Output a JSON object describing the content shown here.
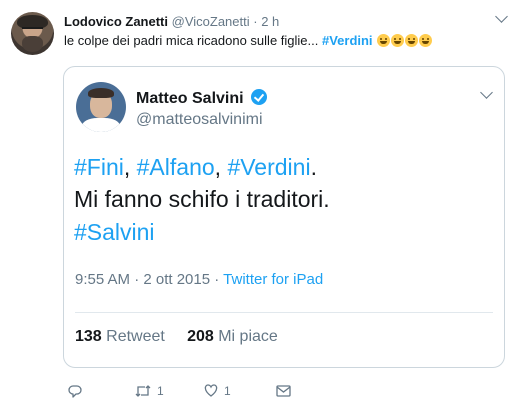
{
  "tweet": {
    "author_name": "Lodovico Zanetti",
    "author_handle": "@VicoZanetti",
    "separator": "·",
    "time": "2 h",
    "text_prefix": "le colpe dei padri mica ricadono sulle figlie... ",
    "hashtag": "#Verdini"
  },
  "quoted": {
    "name": "Matteo Salvini",
    "handle": "@matteosalvinimi",
    "line1": {
      "tag1": "#Fini",
      "sep1": ", ",
      "tag2": "#Alfano",
      "sep2": ", ",
      "tag3": "#Verdini",
      "end": "."
    },
    "line2": "Mi fanno schifo i traditori.",
    "line3": "#Salvini",
    "timestamp": "9:55 AM · 2 ott 2015 · ",
    "source": "Twitter for iPad",
    "retweets_count": "138",
    "retweets_label": " Retweet",
    "likes_count": "208",
    "likes_label": " Mi piace"
  },
  "actions": {
    "retweet_count": "1",
    "like_count": "1"
  },
  "icons": [
    "reply-icon",
    "retweet-icon",
    "heart-icon",
    "envelope-icon",
    "chevron-down-icon",
    "verified-badge-icon",
    "laughing-emoji"
  ],
  "colors": {
    "link": "#1da1f2",
    "meta": "#657786",
    "border": "#ccd6dd"
  }
}
